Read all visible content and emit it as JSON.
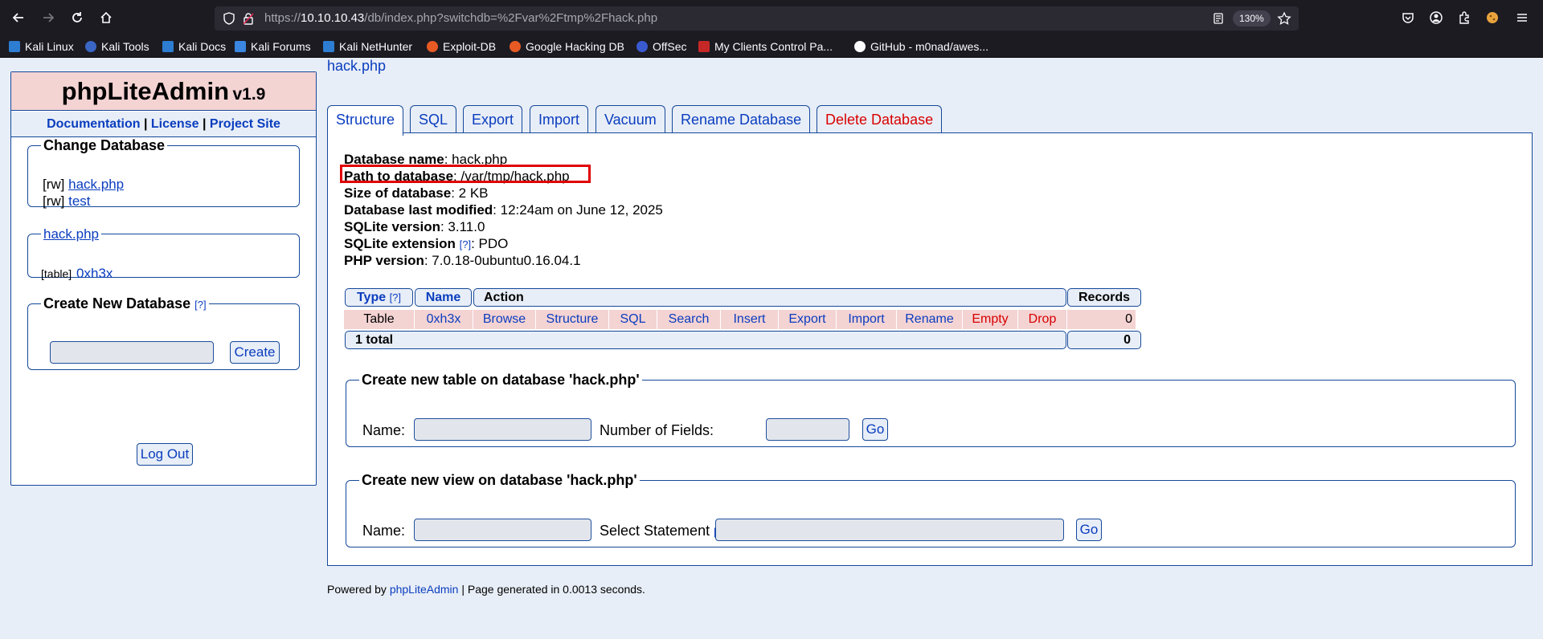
{
  "browser": {
    "url_prefix": "https://",
    "url_host": "10.10.10.43",
    "url_path": "/db/index.php?switchdb=%2Fvar%2Ftmp%2Fhack.php",
    "zoom": "130%",
    "bookmarks": [
      "Kali Linux",
      "Kali Tools",
      "Kali Docs",
      "Kali Forums",
      "Kali NetHunter",
      "Exploit-DB",
      "Google Hacking DB",
      "OffSec",
      "My Clients Control Pa...",
      "GitHub - m0nad/awes..."
    ]
  },
  "sidebar": {
    "logo": "phpLiteAdmin",
    "version": "v1.9",
    "links": {
      "documentation": "Documentation",
      "sep": "|",
      "license": "License",
      "project": "Project Site"
    },
    "change_db": {
      "legend": "Change Database",
      "items": [
        {
          "tag": "[rw]",
          "name": "hack.php"
        },
        {
          "tag": "[rw]",
          "name": "test"
        }
      ]
    },
    "db_tables": {
      "legend": "hack.php",
      "tag": "[table]",
      "table": "0xh3x"
    },
    "create_db": {
      "legend": "Create New Database",
      "help": "[?]",
      "button": "Create"
    },
    "logout": "Log Out"
  },
  "main": {
    "title": "hack.php",
    "tabs": [
      "Structure",
      "SQL",
      "Export",
      "Import",
      "Vacuum",
      "Rename Database",
      "Delete Database"
    ],
    "info": [
      {
        "label": "Database name",
        "value": ": hack.php"
      },
      {
        "label": "Path to database",
        "value": ": /var/tmp/hack.php"
      },
      {
        "label": "Size of database",
        "value": ": 2 KB"
      },
      {
        "label": "Database last modified",
        "value": ": 12:24am on June 12, 2025"
      },
      {
        "label": "SQLite version",
        "value": ": 3.11.0"
      },
      {
        "label": "SQLite extension",
        "help": "[?]",
        "value": ": PDO"
      },
      {
        "label": "PHP version",
        "value": ": 7.0.18-0ubuntu0.16.04.1"
      }
    ],
    "table": {
      "headers": {
        "type": "Type",
        "type_help": "[?]",
        "name": "Name",
        "action": "Action",
        "records": "Records"
      },
      "row": {
        "type": "Table",
        "name": "0xh3x",
        "actions": [
          "Browse",
          "Structure",
          "SQL",
          "Search",
          "Insert",
          "Export",
          "Import",
          "Rename",
          "Empty",
          "Drop"
        ],
        "records": "0"
      },
      "total_label": "1 total",
      "total_records": "0"
    },
    "new_table": {
      "legend": "Create new table on database 'hack.php'",
      "name_label": "Name:",
      "fields_label": "Number of Fields:",
      "button": "Go"
    },
    "new_view": {
      "legend": "Create new view on database 'hack.php'",
      "name_label": "Name:",
      "statement_label": "Select Statement",
      "help": "[?]",
      "colon": ":",
      "button": "Go"
    }
  },
  "footer": {
    "prefix": "Powered by",
    "link": "phpLiteAdmin",
    "suffix": "| Page generated in 0.0013 seconds."
  }
}
